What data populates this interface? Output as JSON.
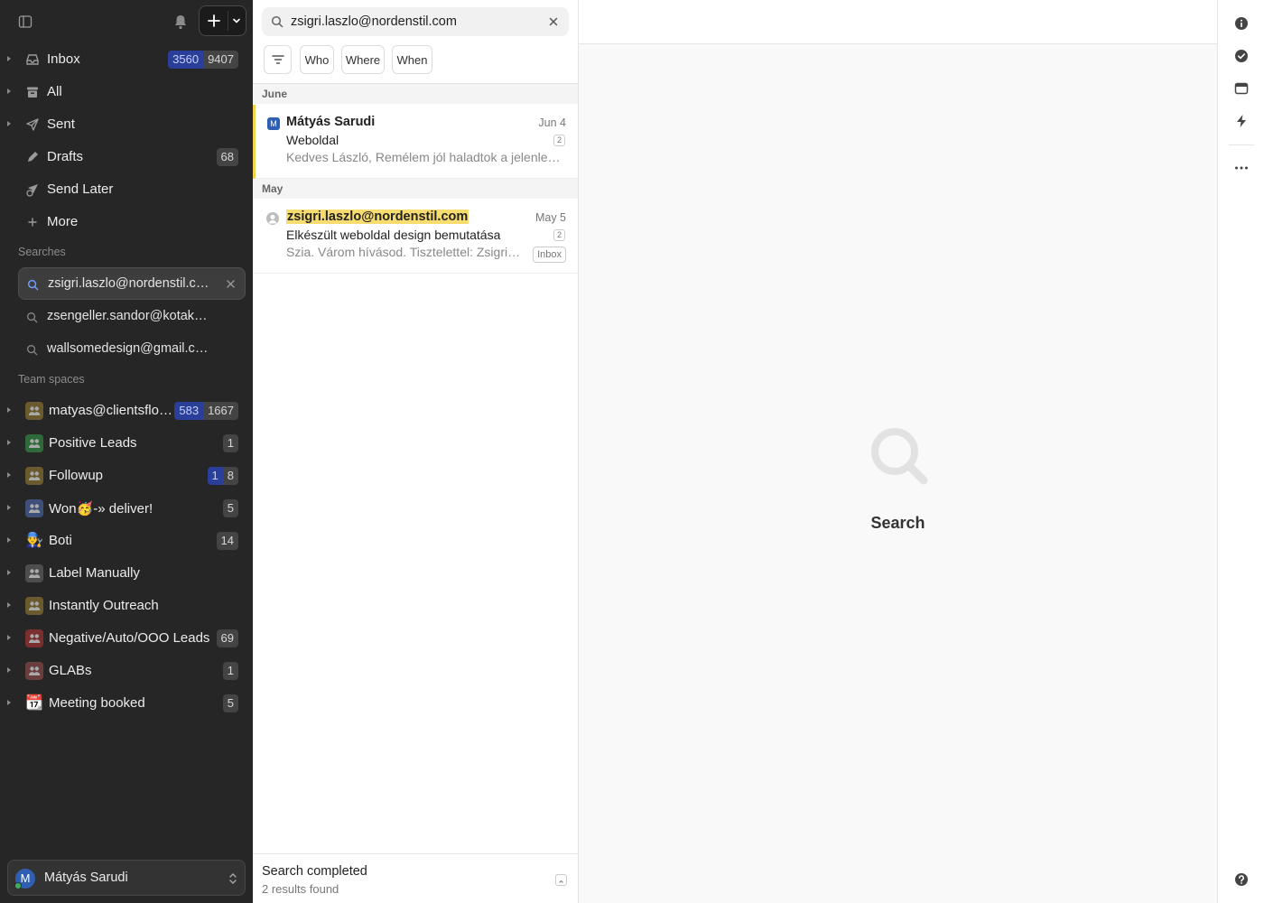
{
  "sidebar": {
    "nav": [
      {
        "label": "Inbox",
        "icon": "inbox-icon",
        "unread": "3560",
        "total": "9407"
      },
      {
        "label": "All",
        "icon": "archive-icon"
      },
      {
        "label": "Sent",
        "icon": "sent-icon"
      },
      {
        "label": "Drafts",
        "icon": "pencil-icon",
        "count": "68"
      },
      {
        "label": "Send Later",
        "icon": "send-later-icon"
      },
      {
        "label": "More",
        "icon": "plus-icon"
      }
    ],
    "searches_title": "Searches",
    "searches": [
      {
        "label": "zsigri.laszlo@nordenstil.com",
        "active": true
      },
      {
        "label": "zsengeller.sandor@kotakkft.hu"
      },
      {
        "label": "wallsomedesign@gmail.com"
      }
    ],
    "team_title": "Team spaces",
    "teams": [
      {
        "label": "matyas@clientsflow.hu",
        "unread": "583",
        "total": "1667",
        "color": "#6b5a2e"
      },
      {
        "label": "Positive Leads",
        "count": "1",
        "color": "#2f6b3a"
      },
      {
        "label": "Followup",
        "unread": "1",
        "total": "8",
        "color": "#6b5a2e"
      },
      {
        "label": "Won🥳-» deliver!",
        "count": "5",
        "color": "#3e4f7a"
      },
      {
        "label": "Boti",
        "count": "14",
        "color": "#3e4f7a",
        "emoji": "👨‍🔧"
      },
      {
        "label": "Label Manually",
        "color": "#4d4d4d"
      },
      {
        "label": "Instantly Outreach",
        "color": "#6b5a2e"
      },
      {
        "label": "Negative/Auto/OOO Leads",
        "count": "69",
        "color": "#7a2e2e"
      },
      {
        "label": "GLABs",
        "count": "1",
        "color": "#6b3e3e"
      },
      {
        "label": "Meeting booked",
        "count": "5",
        "color": "#7a4a2e",
        "emoji": "📆"
      }
    ],
    "user": {
      "name": "Mátyás Sarudi",
      "initial": "M"
    }
  },
  "search": {
    "query": "zsigri.laszlo@nordenstil.com",
    "filters": [
      "Who",
      "Where",
      "When"
    ]
  },
  "groups": [
    {
      "label": "June",
      "messages": [
        {
          "from": "Mátyás Sarudi",
          "avatar": "M",
          "date": "Jun 4",
          "subject": "Weboldal",
          "threads": "2",
          "preview": "Kedves László, Remélem jól haladtok a jelenlegi projekttel."
        }
      ]
    },
    {
      "label": "May",
      "messages": [
        {
          "from": "zsigri.laszlo@nordenstil.com",
          "date": "May 5",
          "subject": "Elkészült weboldal design bemutatása",
          "threads": "2",
          "preview": "Szia. Várom hívásod. Tisztelettel: Zsigri László",
          "label": "Inbox"
        }
      ]
    }
  ],
  "status": {
    "title": "Search completed",
    "subtitle": "2 results found"
  },
  "main": {
    "empty_title": "Search"
  },
  "colors": {
    "sidebar_bg": "#262626",
    "unread_badge": "#2a3f9a",
    "highlight": "#f7dc6f"
  }
}
